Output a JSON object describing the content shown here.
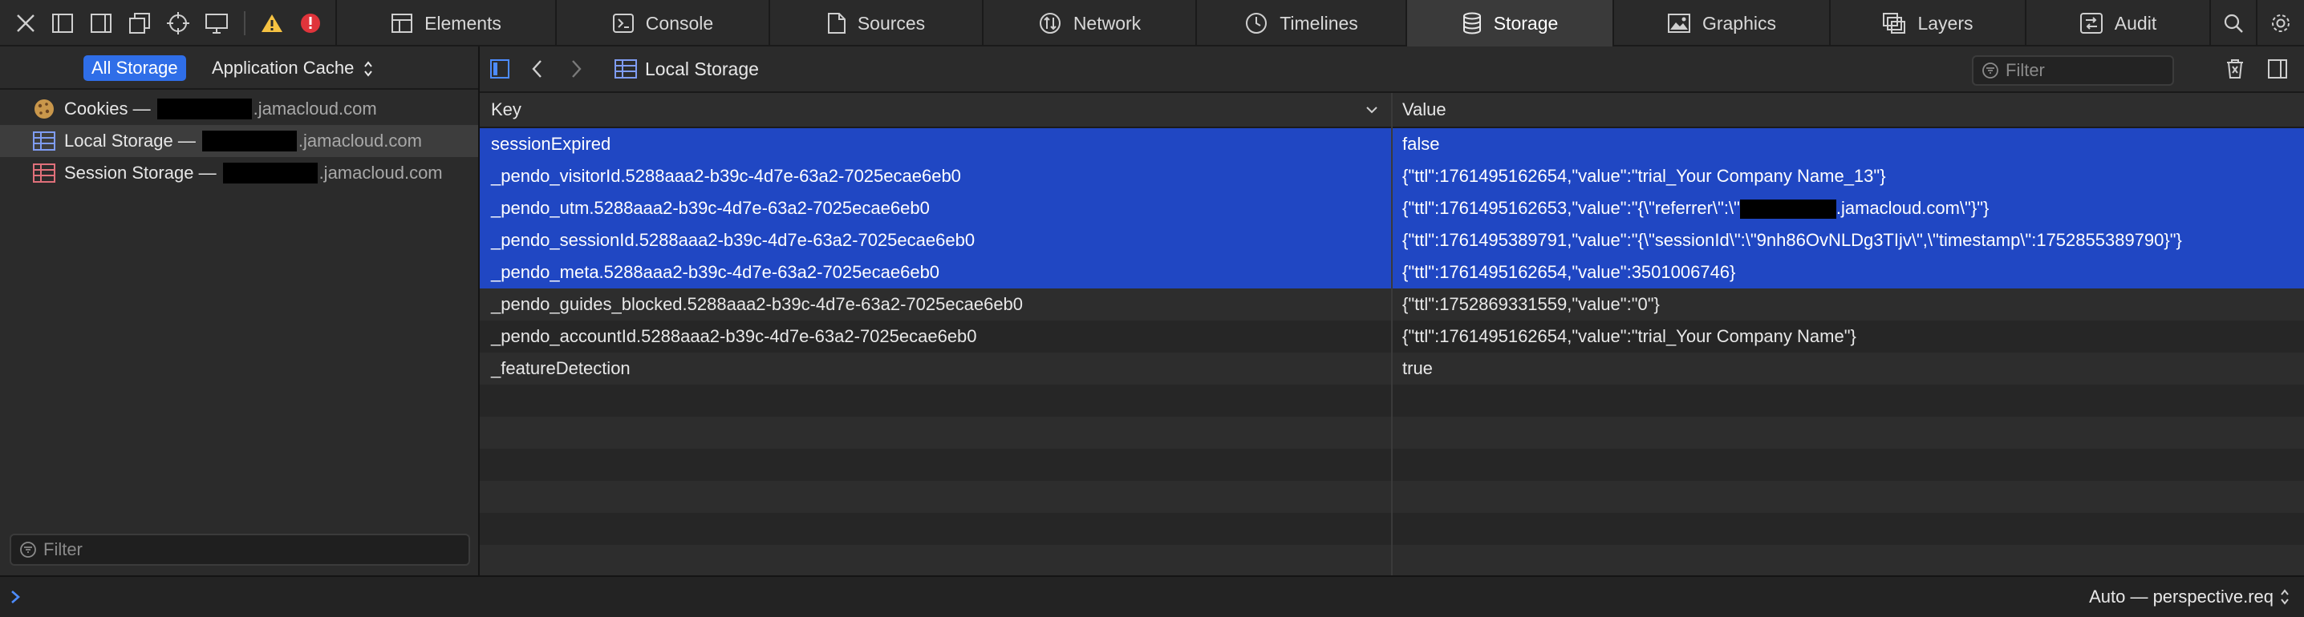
{
  "toolbar": {
    "tabs": [
      {
        "label": "Elements",
        "icon": "elements-icon"
      },
      {
        "label": "Console",
        "icon": "console-icon"
      },
      {
        "label": "Sources",
        "icon": "sources-icon"
      },
      {
        "label": "Network",
        "icon": "network-icon"
      },
      {
        "label": "Timelines",
        "icon": "timelines-icon"
      },
      {
        "label": "Storage",
        "icon": "storage-icon",
        "selected": true
      },
      {
        "label": "Graphics",
        "icon": "graphics-icon"
      },
      {
        "label": "Layers",
        "icon": "layers-icon"
      },
      {
        "label": "Audit",
        "icon": "audit-icon"
      }
    ],
    "error_badge": "!"
  },
  "sidebar": {
    "scope": {
      "all_storage": "All Storage",
      "app_cache": "Application Cache"
    },
    "items": [
      {
        "label": "Cookies",
        "separator": "—",
        "domain": ".jamacloud.com",
        "icon": "cookie-icon"
      },
      {
        "label": "Local Storage",
        "separator": "—",
        "domain": ".jamacloud.com",
        "icon": "local-storage-icon",
        "selected": true
      },
      {
        "label": "Session Storage",
        "separator": "—",
        "domain": ".jamacloud.com",
        "icon": "session-storage-icon"
      }
    ],
    "filter_placeholder": "Filter"
  },
  "content": {
    "nav_title": "Local Storage",
    "filter_placeholder": "Filter",
    "columns": {
      "key": "Key",
      "value": "Value"
    },
    "rows": [
      {
        "key": "sessionExpired",
        "value": "false",
        "selected": true
      },
      {
        "key": "_pendo_visitorId.5288aaa2-b39c-4d7e-63a2-7025ecae6eb0",
        "value": "{\"ttl\":1761495162654,\"value\":\"trial_Your Company Name_13\"}",
        "selected": true
      },
      {
        "key": "_pendo_utm.5288aaa2-b39c-4d7e-63a2-7025ecae6eb0",
        "value_prefix": "{\"ttl\":1761495162653,\"value\":\"{\\\"referrer\\\":\\\"",
        "value_suffix": ".jamacloud.com\\\"}\"}",
        "selected": true
      },
      {
        "key": "_pendo_sessionId.5288aaa2-b39c-4d7e-63a2-7025ecae6eb0",
        "value": "{\"ttl\":1761495389791,\"value\":\"{\\\"sessionId\\\":\\\"9nh86OvNLDg3TIjv\\\",\\\"timestamp\\\":1752855389790}\"}",
        "selected": true
      },
      {
        "key": "_pendo_meta.5288aaa2-b39c-4d7e-63a2-7025ecae6eb0",
        "value": "{\"ttl\":1761495162654,\"value\":3501006746}",
        "selected": true
      },
      {
        "key": "_pendo_guides_blocked.5288aaa2-b39c-4d7e-63a2-7025ecae6eb0",
        "value": "{\"ttl\":1752869331559,\"value\":\"0\"}",
        "selected": false
      },
      {
        "key": "_pendo_accountId.5288aaa2-b39c-4d7e-63a2-7025ecae6eb0",
        "value": "{\"ttl\":1761495162654,\"value\":\"trial_Your Company Name\"}",
        "selected": false
      },
      {
        "key": "_featureDetection",
        "value": "true",
        "selected": false
      }
    ]
  },
  "console": {
    "context": "Auto — perspective.req"
  },
  "colors": {
    "accent": "#2f6ee8",
    "selection": "#2047c3",
    "warning": "#f5c242",
    "error": "#e0343b"
  }
}
